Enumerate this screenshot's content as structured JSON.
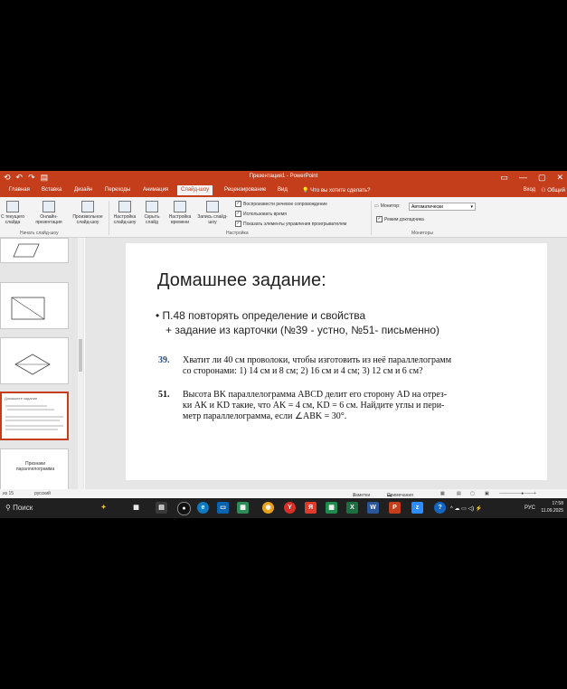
{
  "app": {
    "window_title": "Презентация1 - PowerPoint",
    "qat": [
      "⟲",
      "↶",
      "↷",
      "▤"
    ],
    "window_controls": [
      "▭",
      "—",
      "▢",
      "✕"
    ]
  },
  "tabs": [
    "Главная",
    "Вставка",
    "Дизайн",
    "Переходы",
    "Анимация",
    "Слайд-шоу",
    "Рецензирование",
    "Вид"
  ],
  "active_tab": "Слайд-шоу",
  "tell_me": "Что вы хотите сделать?",
  "account": {
    "signin": "Вход",
    "share": "Общий"
  },
  "ribbon": {
    "group1": {
      "label": "Начать слайд-шоу",
      "buttons": [
        "С текущего слайда",
        "Онлайн-презентация",
        "Произвольное слайд-шоу"
      ]
    },
    "group2": {
      "label": "Настройка",
      "buttons": [
        "Настройка слайд-шоу",
        "Скрыть слайд",
        "Настройка времени",
        "Запись слайд-шоу"
      ],
      "checks": [
        "Воспроизвести речевое сопровождение",
        "Использовать время",
        "Показать элементы управления проигрывателем"
      ]
    },
    "group3": {
      "label": "Мониторы",
      "monitor_label": "Монитор:",
      "monitor_value": "Автоматически",
      "presenter_view": "Режим докладчика"
    }
  },
  "thumbnails": {
    "slide5_title": "Домашнее задание",
    "slide6_text": "Признаки параллелограмма"
  },
  "slide": {
    "title": "Домашнее задание:",
    "bullet1": "• П.48 повторять определение и свойства",
    "bullet2": "+ задание из карточки (№39 - устно, №51- письменно)",
    "problems": [
      {
        "num": "39.",
        "lines": [
          "Хватит ли 40 см проволоки, чтобы изготовить из неё параллелограмм",
          "со сторонами: 1) 14 см и 8 см; 2) 16 см и 4 см; 3) 12 см и 6 см?"
        ]
      },
      {
        "num": "51.",
        "lines": [
          "Высота BK параллелограмма ABCD делит его сторону AD на отрез-",
          "ки AK и KD такие, что AK = 4 см, KD = 6 см. Найдите углы и пери-",
          "метр параллелограмма, если ∠ABK = 30°."
        ]
      }
    ]
  },
  "status": {
    "slide_info": "из 15",
    "language": "русский",
    "notes": "Заметки",
    "comments": "Примечания"
  },
  "taskbar": {
    "search": "Поиск",
    "lang": "РУС",
    "time": "17:58",
    "date": "11.09.2025"
  },
  "colors": {
    "accent": "#c43e1c",
    "problem_num": "#2a4f8a"
  }
}
